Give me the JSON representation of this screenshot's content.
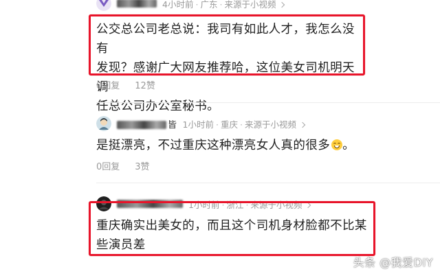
{
  "comments": [
    {
      "username_visible": "",
      "time": "4小时前",
      "location": "广东",
      "source": "来源于小视频",
      "text": "公交总公司老总说：我司有如此人才，我怎么没有发现？感谢广大网友推荐哈，这位美女司机明天调任总公司办公室秘书。",
      "text_lines": [
        "公交总公司老总说：我司有如此人才，我怎么没有",
        "发现？感谢广大网友推荐哈，这位美女司机明天调",
        "任总公司办公室秘书。"
      ],
      "reply_label": "0回复",
      "likes_label": "12赞",
      "highlighted": true
    },
    {
      "username_visible": "皆",
      "time": "1小时前",
      "location": "重庆",
      "source": "来源于小视频",
      "text_lines": [
        "是挺漂亮，不过重庆这种漂亮女人真的很多"
      ],
      "emoji": "grinning-face-icon",
      "reply_label": "0回复",
      "likes_label": "3赞",
      "highlighted": false
    },
    {
      "username_visible": "",
      "time": "1小时前",
      "location": "浙江",
      "source": "来源于小视频",
      "text_lines": [
        "重庆确实出美女的，而且这个司机身材脸都不比某",
        "些演员差"
      ],
      "highlighted": true
    }
  ],
  "watermark": "头条 @我爱DIY",
  "colors": {
    "highlight_border": "#e8142a",
    "meta": "#9a9a9a",
    "text": "#1f1f1f"
  }
}
